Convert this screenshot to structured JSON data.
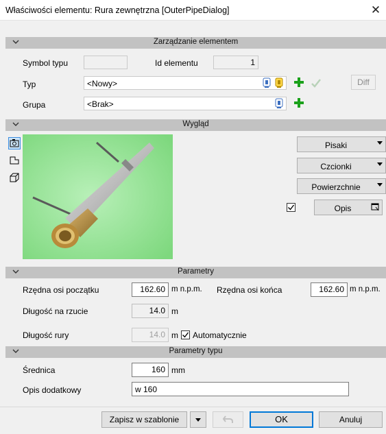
{
  "window": {
    "title": "Właściwości elementu: Rura zewnętrzna [OuterPipeDialog]"
  },
  "sections": {
    "management": "Zarządzanie elementem",
    "appearance": "Wygląd",
    "parameters": "Parametry",
    "type_parameters": "Parametry typu"
  },
  "management": {
    "symbol_label": "Symbol typu",
    "symbol_value": "",
    "id_label": "Id elementu",
    "id_value": "1",
    "type_label": "Typ",
    "type_value": "<Nowy>",
    "diff_label": "Diff",
    "group_label": "Grupa",
    "group_value": "<Brak>"
  },
  "appearance": {
    "pens": "Pisaki",
    "fonts": "Czcionki",
    "surfaces": "Powierzchnie",
    "description": "Opis",
    "description_checked": true
  },
  "parameters": {
    "start_elev_label": "Rzędna osi początku",
    "start_elev_value": "162.60",
    "start_elev_unit": "m n.p.m.",
    "end_elev_label": "Rzędna osi końca",
    "end_elev_value": "162.60",
    "end_elev_unit": "m n.p.m.",
    "plan_length_label": "Długość na rzucie",
    "plan_length_value": "14.0",
    "plan_length_unit": "m",
    "pipe_length_label": "Długość rury",
    "pipe_length_value": "14.0",
    "pipe_length_unit": "m",
    "automatic_label": "Automatycznie",
    "automatic_checked": true
  },
  "type_parameters": {
    "diameter_label": "Średnica",
    "diameter_value": "160",
    "diameter_unit": "mm",
    "extra_desc_label": "Opis dodatkowy",
    "extra_desc_value": "w 160"
  },
  "footer": {
    "save_template": "Zapisz w szablonie",
    "ok": "OK",
    "cancel": "Anuluj"
  },
  "colors": {
    "preview_bg": "#9be69b",
    "section_bg": "#c2c2c2",
    "accent": "#0078d7",
    "plus_green": "#1aa11a"
  }
}
